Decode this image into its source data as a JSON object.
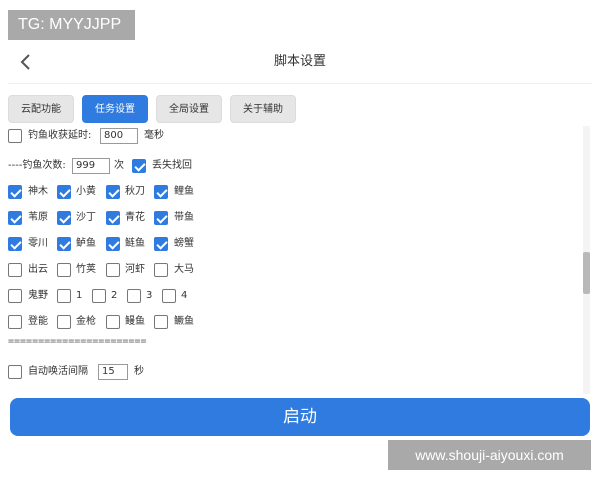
{
  "watermark_top": "TG: MYYJJPP",
  "watermark_bottom": "www.shouji-aiyouxi.com",
  "header": {
    "title": "脚本设置",
    "back_icon": "chevron-left-icon"
  },
  "tabs": [
    {
      "label": "云配功能",
      "active": false
    },
    {
      "label": "任务设置",
      "active": true
    },
    {
      "label": "全局设置",
      "active": false
    },
    {
      "label": "关于辅助",
      "active": false
    }
  ],
  "settings": {
    "catch_delay": {
      "label": "钓鱼收获延时:",
      "value": "800",
      "unit": "毫秒",
      "checked": false
    },
    "fishing_count": {
      "label": "----钓鱼次数:",
      "value": "999",
      "unit": "次"
    },
    "lost_recovery": {
      "label": "丢失找回",
      "checked": true
    },
    "fish_rows": [
      [
        {
          "label": "神木",
          "checked": true
        },
        {
          "label": "小黄",
          "checked": true
        },
        {
          "label": "秋刀",
          "checked": true
        },
        {
          "label": "鲤鱼",
          "checked": true
        }
      ],
      [
        {
          "label": "苇原",
          "checked": true
        },
        {
          "label": "沙丁",
          "checked": true
        },
        {
          "label": "青花",
          "checked": true
        },
        {
          "label": "带鱼",
          "checked": true
        }
      ],
      [
        {
          "label": "零川",
          "checked": true
        },
        {
          "label": "鲈鱼",
          "checked": true
        },
        {
          "label": "鲢鱼",
          "checked": true
        },
        {
          "label": "螃蟹",
          "checked": true
        }
      ],
      [
        {
          "label": "出云",
          "checked": false
        },
        {
          "label": "竹荚",
          "checked": false
        },
        {
          "label": "河虾",
          "checked": false
        },
        {
          "label": "大马",
          "checked": false
        }
      ]
    ],
    "extra_row": [
      {
        "label": "鬼野",
        "checked": false
      },
      {
        "label": "1",
        "checked": false
      },
      {
        "label": "2",
        "checked": false
      },
      {
        "label": "3",
        "checked": false
      },
      {
        "label": "4",
        "checked": false
      }
    ],
    "bottom_row": [
      {
        "label": "登能",
        "checked": false
      },
      {
        "label": "金枪",
        "checked": false
      },
      {
        "label": "鳗鱼",
        "checked": false
      },
      {
        "label": "鳜鱼",
        "checked": false
      }
    ],
    "separator": "=======================",
    "auto_wake": {
      "label": "自动唤活间隔",
      "value": "15",
      "unit": "秒",
      "checked": false
    }
  },
  "start_button": "启动",
  "colors": {
    "accent": "#2f7bdf",
    "watermark": "#a9a9a9"
  }
}
